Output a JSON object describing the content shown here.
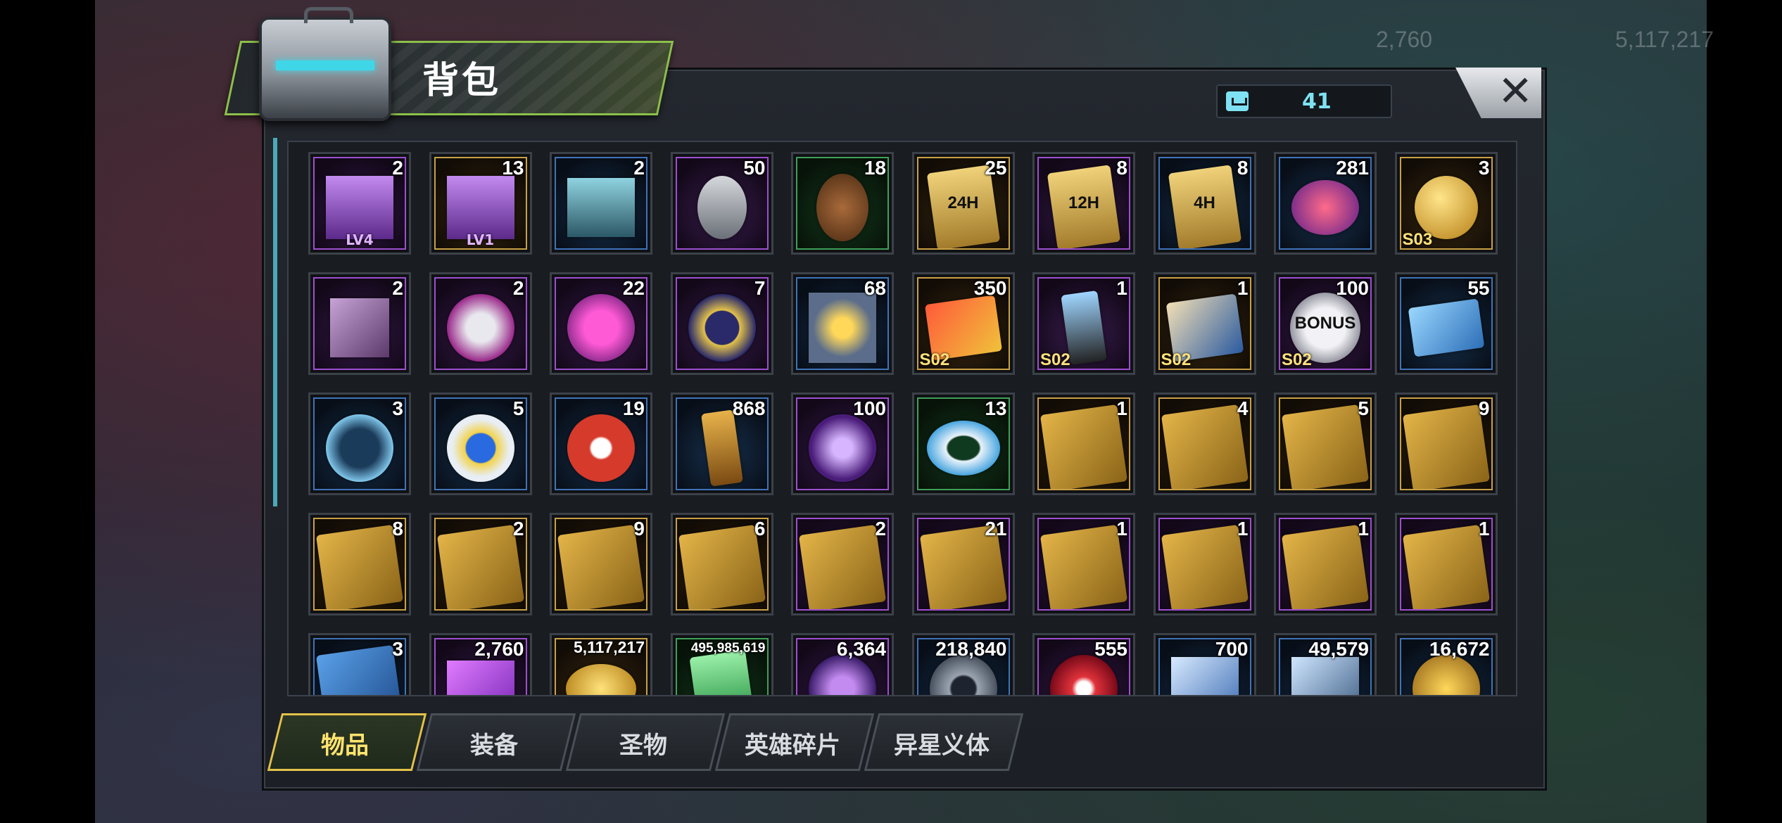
{
  "scene": {
    "top_resources": [
      "2,760",
      "5,117,217"
    ]
  },
  "panel": {
    "title": "背包",
    "capacity_value": "41",
    "close_label": "✕"
  },
  "items": [
    {
      "count": "2",
      "rarity": "purple",
      "art": "chest-purple",
      "sub": "LV4"
    },
    {
      "count": "13",
      "rarity": "gold",
      "art": "chest-purple",
      "sub": "LV1"
    },
    {
      "count": "2",
      "rarity": "blue",
      "art": "chest-steel",
      "sub": ""
    },
    {
      "count": "50",
      "rarity": "purple",
      "art": "grenade",
      "sub": ""
    },
    {
      "count": "18",
      "rarity": "green",
      "art": "pinecone",
      "sub": ""
    },
    {
      "count": "25",
      "rarity": "gold",
      "art": "speedup-card",
      "label": "24H"
    },
    {
      "count": "8",
      "rarity": "purple",
      "art": "speedup-card",
      "label": "12H"
    },
    {
      "count": "8",
      "rarity": "blue",
      "art": "speedup-card",
      "label": "4H"
    },
    {
      "count": "281",
      "rarity": "blue",
      "art": "lips-badge",
      "sub": ""
    },
    {
      "count": "3",
      "rarity": "gold",
      "art": "golden-skull",
      "tag": "S03"
    },
    {
      "count": "2",
      "rarity": "purple",
      "art": "cube-ring",
      "sub": ""
    },
    {
      "count": "2",
      "rarity": "purple",
      "art": "film-reel",
      "sub": ""
    },
    {
      "count": "22",
      "rarity": "purple",
      "art": "s-bottlecap",
      "sub": ""
    },
    {
      "count": "7",
      "rarity": "purple",
      "art": "poker-chip",
      "sub": ""
    },
    {
      "count": "68",
      "rarity": "blue",
      "art": "police-badge",
      "sub": ""
    },
    {
      "count": "350",
      "rarity": "gold",
      "art": "ticket-card",
      "tag": "S02"
    },
    {
      "count": "1",
      "rarity": "purple",
      "art": "flashlight",
      "tag": "S02"
    },
    {
      "count": "1",
      "rarity": "gold",
      "art": "eye-scroll",
      "tag": "S02"
    },
    {
      "count": "100",
      "rarity": "purple",
      "art": "bonus-coin",
      "label": "BONUS",
      "tag": "S02"
    },
    {
      "count": "55",
      "rarity": "blue",
      "art": "cinema-ticket",
      "sub": ""
    },
    {
      "count": "3",
      "rarity": "blue",
      "art": "timer-badge",
      "sub": ""
    },
    {
      "count": "5",
      "rarity": "blue",
      "art": "b-bottlecap",
      "sub": ""
    },
    {
      "count": "19",
      "rarity": "blue",
      "art": "red-chip",
      "sub": ""
    },
    {
      "count": "868",
      "rarity": "blue",
      "art": "bullet",
      "sub": ""
    },
    {
      "count": "100",
      "rarity": "purple",
      "art": "magic-mirror",
      "sub": ""
    },
    {
      "count": "13",
      "rarity": "green",
      "art": "swim-ring",
      "sub": ""
    },
    {
      "count": "1",
      "rarity": "gold",
      "art": "blueprint-shirt",
      "sub": ""
    },
    {
      "count": "4",
      "rarity": "gold",
      "art": "blueprint-glasses",
      "sub": ""
    },
    {
      "count": "5",
      "rarity": "gold",
      "art": "blueprint-glasses",
      "sub": ""
    },
    {
      "count": "9",
      "rarity": "gold",
      "art": "blueprint-shirt",
      "sub": ""
    },
    {
      "count": "8",
      "rarity": "gold",
      "art": "blueprint-boot",
      "sub": ""
    },
    {
      "count": "2",
      "rarity": "gold",
      "art": "blueprint-gun",
      "sub": ""
    },
    {
      "count": "9",
      "rarity": "gold",
      "art": "blueprint-swords",
      "sub": ""
    },
    {
      "count": "6",
      "rarity": "gold",
      "art": "blueprint-hat",
      "sub": ""
    },
    {
      "count": "2",
      "rarity": "purple",
      "art": "blueprint-boot",
      "sub": ""
    },
    {
      "count": "21",
      "rarity": "purple",
      "art": "blueprint-shirt",
      "sub": ""
    },
    {
      "count": "1",
      "rarity": "purple",
      "art": "blueprint-glasses",
      "sub": ""
    },
    {
      "count": "1",
      "rarity": "purple",
      "art": "blueprint-hat",
      "sub": ""
    },
    {
      "count": "1",
      "rarity": "purple",
      "art": "blueprint-gun",
      "sub": ""
    },
    {
      "count": "1",
      "rarity": "purple",
      "art": "blueprint-swords",
      "sub": ""
    },
    {
      "count": "3",
      "rarity": "blue",
      "art": "blueprint-blue",
      "sub": ""
    },
    {
      "count": "2,760",
      "rarity": "purple",
      "art": "purple-gems",
      "sub": ""
    },
    {
      "count": "5,117,217",
      "rarity": "gold",
      "art": "gold-coins",
      "sub": ""
    },
    {
      "count": "495,985,619",
      "rarity": "green",
      "art": "green-potion",
      "sub": ""
    },
    {
      "count": "6,364",
      "rarity": "purple",
      "art": "purple-orb",
      "sub": ""
    },
    {
      "count": "218,840",
      "rarity": "blue",
      "art": "gear",
      "sub": ""
    },
    {
      "count": "555",
      "rarity": "purple",
      "art": "red-atom",
      "sub": ""
    },
    {
      "count": "700",
      "rarity": "blue",
      "art": "crystal-blue",
      "sub": ""
    },
    {
      "count": "49,579",
      "rarity": "blue",
      "art": "tech-cube",
      "sub": ""
    },
    {
      "count": "16,672",
      "rarity": "blue",
      "art": "gold-fist",
      "sub": ""
    }
  ],
  "tabs": [
    {
      "label": "物品",
      "active": true
    },
    {
      "label": "装备",
      "active": false
    },
    {
      "label": "圣物",
      "active": false
    },
    {
      "label": "英雄碎片",
      "active": false
    },
    {
      "label": "异星义体",
      "active": false
    }
  ],
  "colors": {
    "accent_cyan": "#7fe2f2",
    "tab_active_border": "#e3c24a",
    "title_border": "#8cc04a",
    "rarity_gold": "#c9a045",
    "rarity_purple": "#9d4fd0",
    "rarity_blue": "#3f73b8",
    "rarity_green": "#3fa05a"
  }
}
